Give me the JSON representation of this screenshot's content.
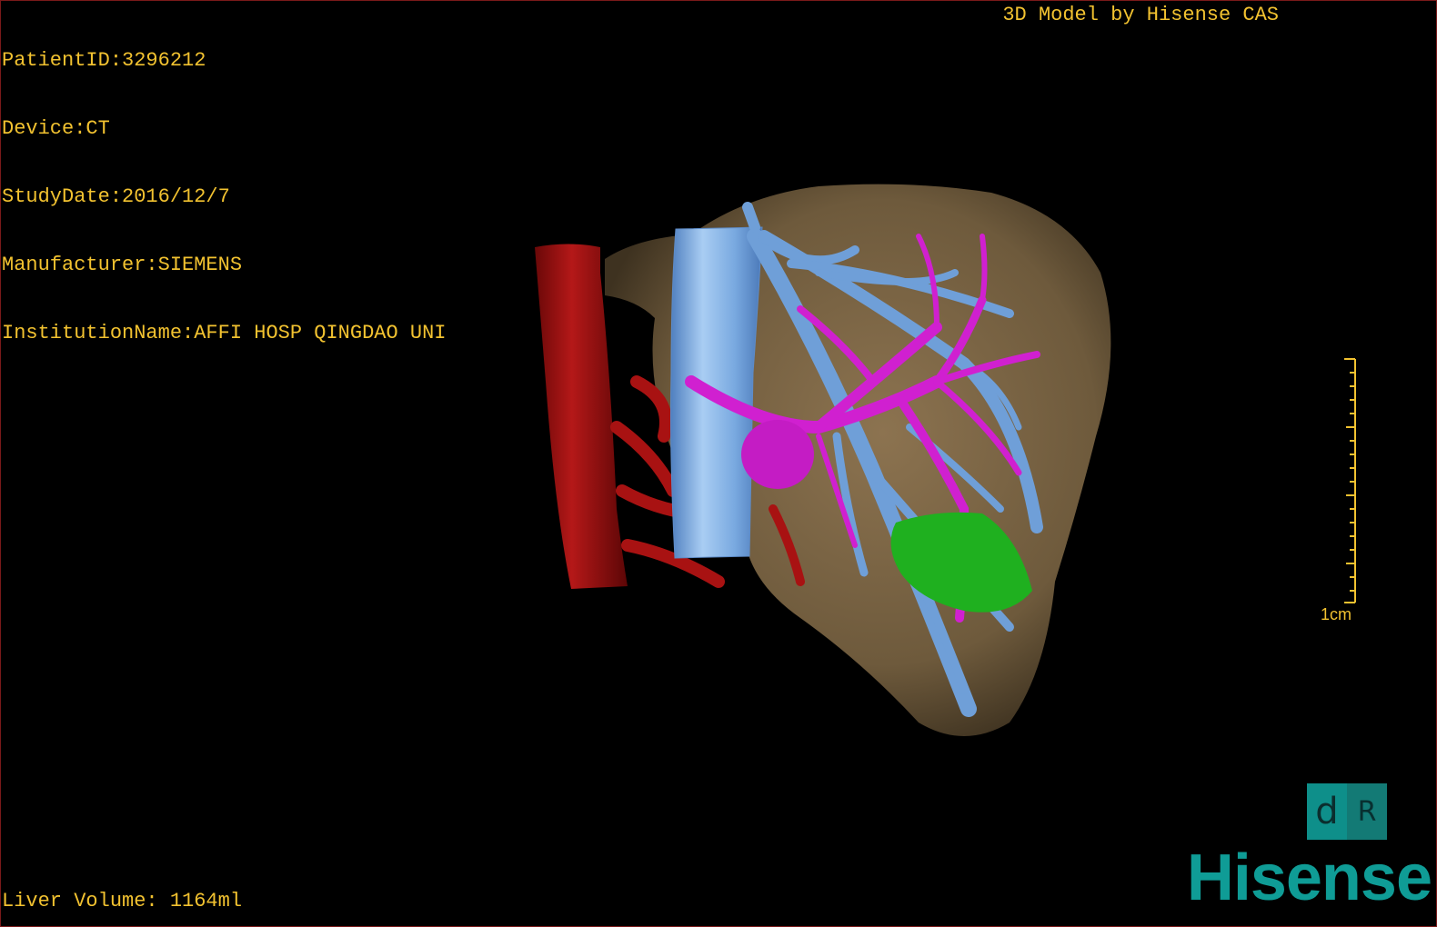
{
  "patient_info": {
    "patient_id": "PatientID:3296212",
    "device": "Device:CT",
    "study_date": "StudyDate:2016/12/7",
    "manufacturer": "Manufacturer:SIEMENS",
    "institution": "InstitutionName:AFFI HOSP QINGDAO UNI"
  },
  "header": {
    "model_credit": "3D Model by Hisense CAS"
  },
  "footer": {
    "liver_volume": "Liver Volume: 1164ml"
  },
  "scale_bar": {
    "label": "1cm"
  },
  "orientation_cube": {
    "left_letter": "d",
    "right_letter": "R"
  },
  "brand": {
    "logo_text": "Hisense"
  },
  "colors": {
    "overlay_text": "#f2c230",
    "liver": "#7d6646",
    "artery": "#a81010",
    "portal_vein": "#d020d0",
    "hepatic_vein": "#6f9fd8",
    "tumor": "#1fb01f",
    "brand": "#0f9c96"
  }
}
